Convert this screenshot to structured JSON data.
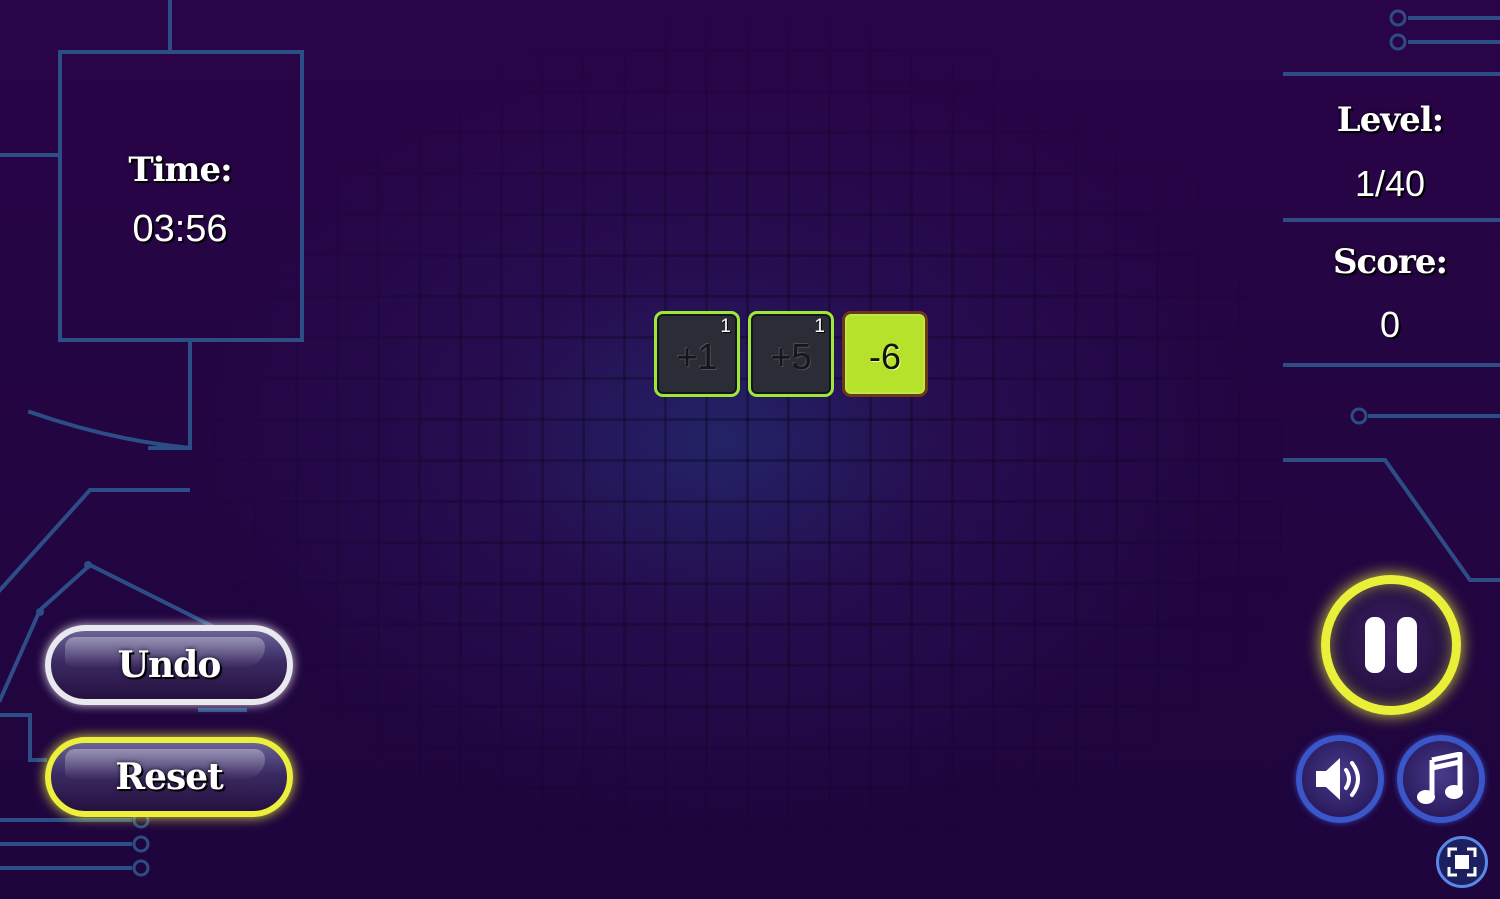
{
  "hud": {
    "time_label": "Time:",
    "time_value": "03:56",
    "level_label": "Level:",
    "level_value": "1/40",
    "score_label": "Score:",
    "score_value": "0"
  },
  "tiles": [
    {
      "text": "+1",
      "count": "1",
      "state": "used"
    },
    {
      "text": "+5",
      "count": "1",
      "state": "used"
    },
    {
      "text": "-6",
      "count": "",
      "state": "active"
    }
  ],
  "buttons": {
    "undo_label": "Undo",
    "reset_label": "Reset"
  },
  "icons": {
    "pause": "pause-icon",
    "sound": "speaker-icon",
    "music": "music-note-icon",
    "fullscreen": "fullscreen-icon"
  },
  "colors": {
    "tile_border_used": "#9fe63a",
    "tile_active_fill": "#b6e22c",
    "pause_ring": "#eaf03a",
    "reset_ring": "#ecf03c",
    "sound_ring": "#3a56c8",
    "circuit_line": "#2c4d86"
  }
}
